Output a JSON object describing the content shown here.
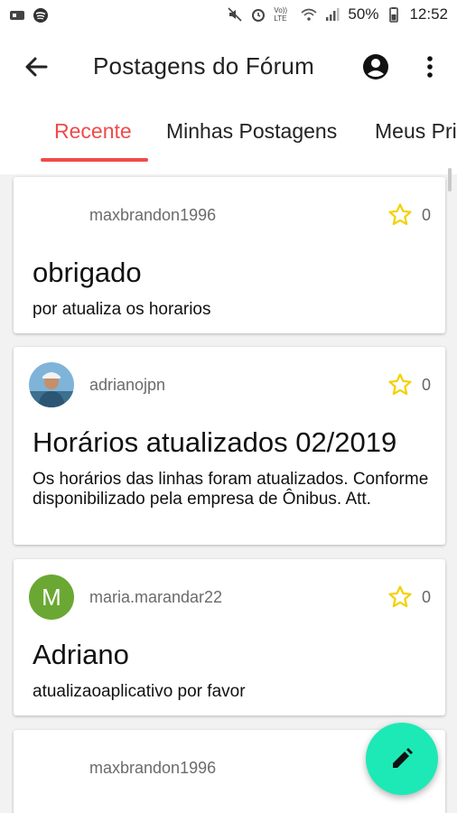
{
  "status_bar": {
    "battery": "50%",
    "time": "12:52",
    "volte": "Vo)) LTE"
  },
  "app_bar": {
    "title": "Postagens do Fórum",
    "back_icon": "arrow-back-icon",
    "account_icon": "account-circle-icon",
    "menu_icon": "more-vert-icon"
  },
  "tabs": [
    {
      "label": "Recente",
      "active": true
    },
    {
      "label": "Minhas Postagens",
      "active": false
    },
    {
      "label": "Meus Pri",
      "active": false
    }
  ],
  "posts": [
    {
      "author": "maxbrandon1996",
      "stars": "0",
      "title": "obrigado",
      "body": "por atualiza os horarios",
      "avatar": "none"
    },
    {
      "author": "adrianojpn",
      "stars": "0",
      "title": "Horários atualizados 02/2019",
      "body": "Os horários das linhas foram atualizados. Conforme disponibilizado pela empresa de Ônibus. Att.",
      "avatar": "photo"
    },
    {
      "author": "maria.marandar22",
      "stars": "0",
      "title": "Adriano",
      "body": "atualizaoaplicativo por favor",
      "avatar": "M"
    },
    {
      "author": "maxbrandon1996",
      "stars": "",
      "title": "",
      "body": "",
      "avatar": "none"
    }
  ],
  "colors": {
    "accent": "#f04a4a",
    "fab": "#1de9b6",
    "star": "#f5d000",
    "avatar_m": "#6aa833"
  }
}
